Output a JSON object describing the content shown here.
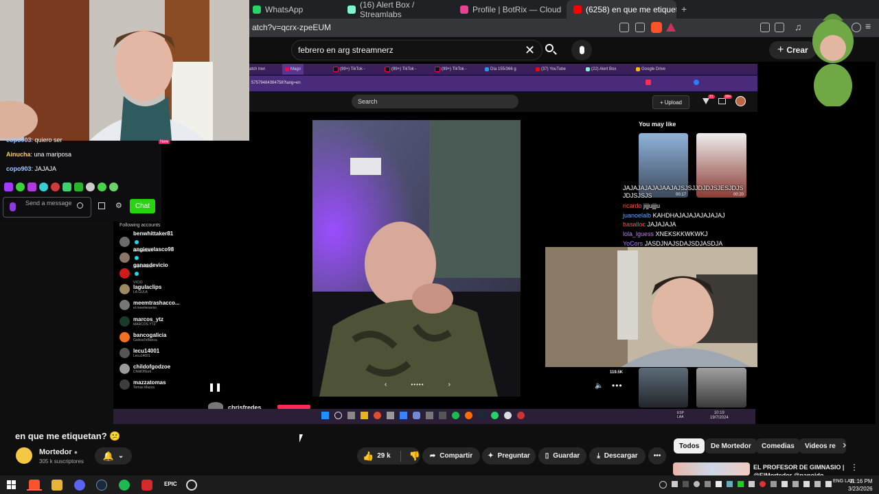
{
  "browser": {
    "tabs": [
      {
        "label": "WhatsApp",
        "color": "#25d366",
        "active": false
      },
      {
        "label": "(16) Alert Box / Streamlabs",
        "color": "#80f5d2",
        "active": false
      },
      {
        "label": "Profile | BotRix — Cloud Streaming B",
        "color": "#e84393",
        "active": false
      },
      {
        "label": "(6258) en que me etiquetan?",
        "color": "#ff0000",
        "active": true
      }
    ],
    "url": "atch?v=qcrx-zpeEUM"
  },
  "youtube": {
    "search_value": "febrero en arg streamnerz",
    "create_label": "Crear"
  },
  "embedded": {
    "inner_tabs": [
      "atch tren",
      "Mago",
      "(99+) TikTok -",
      "(99+) TikTok -",
      "(99+) TikTok -",
      "Día 155/366 g",
      "(37) YouTube",
      "(22) Alert Box",
      "Google Drive"
    ],
    "inner_url": "57579484394758?lang=en",
    "tiktok_search_placeholder": "Search",
    "upload_label": "Upload",
    "notif_badges": [
      "31",
      "99+"
    ],
    "you_may_like": "You may like",
    "next_user": "chrisfredes",
    "thumb_counts": [
      "00:17",
      "00:20"
    ],
    "live_count": "119.5K",
    "stream_chat": [
      {
        "user": "copo903",
        "msg": ": quiero ser"
      },
      {
        "user": "Ainucha",
        "msg": ": una mariposa"
      },
      {
        "user": "copo903",
        "msg": ": JAJAJA"
      }
    ],
    "new_badge": "New",
    "chat_placeholder": "Send a message",
    "chat_button": "Chat",
    "following_title": "Following accounts",
    "following": [
      {
        "name": "benwhittaker81",
        "sub": "benwhittaker",
        "verified": true,
        "color": "#6b6b6b"
      },
      {
        "name": "angievelasco98",
        "sub": "angievelasco",
        "verified": true,
        "color": "#8a7668"
      },
      {
        "name": "ganasdevicio",
        "sub": "VICIO",
        "verified": true,
        "color": "#d11a1a"
      },
      {
        "name": "lagulaclips",
        "sub": "LA GULA",
        "verified": false,
        "color": "#9c8a60"
      },
      {
        "name": "meemtrashacco...",
        "sub": "el meemesemo",
        "verified": false,
        "color": "#777777"
      },
      {
        "name": "marcos_ytz",
        "sub": "MARCOS YTZ",
        "verified": false,
        "color": "#1a3a2a"
      },
      {
        "name": "bancogalicia",
        "sub": "GaliciaTeBanca",
        "verified": false,
        "color": "#f37021"
      },
      {
        "name": "lecu14001",
        "sub": "Lecu14001",
        "verified": false,
        "color": "#555555"
      },
      {
        "name": "childofgodzoe",
        "sub": "ChildOfGod",
        "verified": false,
        "color": "#9a9a9a"
      },
      {
        "name": "mazzatomas",
        "sub": "Tomas Mazza",
        "verified": false,
        "color": "#3d3d3d"
      }
    ],
    "overlay_chat": [
      {
        "user": "",
        "msg": "JAJAJAJAJAJAAJAJSJSJJDJDJSJESJDJS JDJSJSJS",
        "color": "#ffffff"
      },
      {
        "user": "ricardo",
        "msg": "jijjujjju",
        "color": "#ff4a4a"
      },
      {
        "user": "juanoelalb",
        "msg": "KAHDHAJAJAJAJAJAJAJ",
        "color": "#6aa7ff"
      },
      {
        "user": "basalloc",
        "msg": "JAJAJAJA",
        "color": "#ff4a4a"
      },
      {
        "user": "lola_lguess",
        "msg": "XNEKSKKWKWKJ",
        "color": "#c07aff"
      },
      {
        "user": "YoCors",
        "msg": "JASDJNAJSDAJSDJASDJA",
        "color": "#b07aff"
      }
    ],
    "inner_clock": {
      "time": "10:19",
      "date": "19/7/2024",
      "lang": "ESP LAA"
    }
  },
  "video": {
    "title": "en que me etiquetan? 😕",
    "channel": "Mortedor",
    "subscribers": "305 k suscriptores",
    "likes": "29 k",
    "share": "Compartir",
    "ask": "Preguntar",
    "save": "Guardar",
    "download": "Descargar"
  },
  "chips": [
    {
      "label": "Todos",
      "active": true
    },
    {
      "label": "De Mortedor",
      "active": false
    },
    {
      "label": "Comedias",
      "active": false
    },
    {
      "label": "Videos re",
      "active": false
    }
  ],
  "recommended": {
    "title": "EL PROFESOR DE GIMNASIO | @ElMortedor @panoido"
  },
  "taskbar": {
    "lang": "ENG LAA",
    "time": "11:16 PM",
    "date": "3/23/2026"
  }
}
